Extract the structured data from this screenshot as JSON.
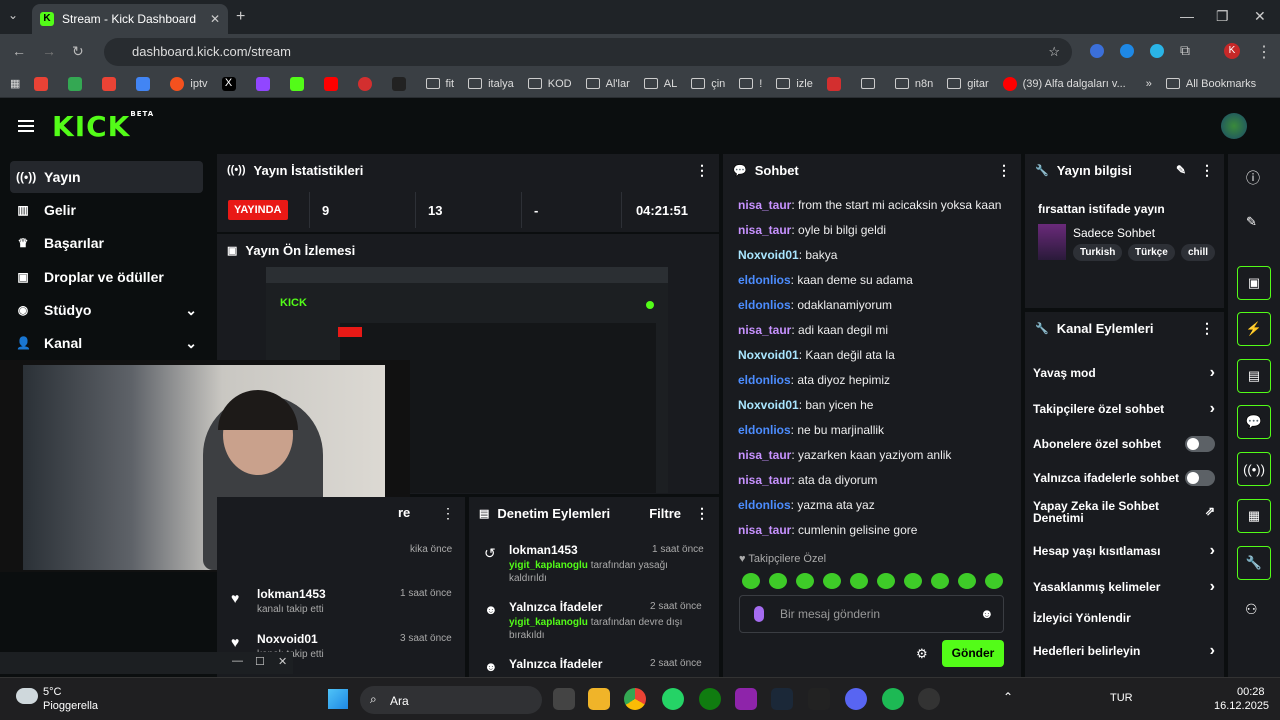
{
  "browser": {
    "tab_title": "Stream - Kick Dashboard",
    "url": "dashboard.kick.com/stream",
    "bookmarks": [
      "iptv",
      "fit",
      "italya",
      "KOD",
      "Al'lar",
      "AL",
      "çin",
      "!",
      "izle",
      "n8n",
      "gitar",
      "(39) Alfa dalgaları v..."
    ],
    "all_bookmarks": "All Bookmarks",
    "profile_letter": "K"
  },
  "header": {
    "logo": "KICK",
    "beta": "BETA"
  },
  "sidebar": {
    "items": [
      {
        "label": "Yayın",
        "icon": "broadcast-icon"
      },
      {
        "label": "Gelir",
        "icon": "chart-icon"
      },
      {
        "label": "Başarılar",
        "icon": "trophy-icon"
      },
      {
        "label": "Droplar ve ödüller",
        "icon": "gift-icon"
      },
      {
        "label": "Stüdyo",
        "icon": "studio-icon"
      },
      {
        "label": "Kanal",
        "icon": "channel-icon"
      }
    ]
  },
  "stats": {
    "title": "Yayın İstatistikleri",
    "live_badge": "YAYINDA",
    "viewers": "9",
    "followers": "13",
    "subs": "-",
    "duration": "04:21:51"
  },
  "preview": {
    "title": "Yayın Ön İzlemesi"
  },
  "activity": {
    "title_partial": "re",
    "time0": "kika önce",
    "items": [
      {
        "name": "lokman1453",
        "text": "kanalı takip etti",
        "time": "1 saat önce"
      },
      {
        "name": "Noxvoid01",
        "text": "kanalı takip etti",
        "time": "3 saat önce"
      }
    ]
  },
  "moderation": {
    "title": "Denetim Eylemleri",
    "filter": "Filtre",
    "items": [
      {
        "name": "lokman1453",
        "mod": "yigit_kaplanoglu",
        "action1": "tarafından yasağı",
        "action2": "kaldırıldı",
        "time": "1 saat önce"
      },
      {
        "name": "Yalnızca İfadeler",
        "mod": "yigit_kaplanoglu",
        "action1": "tarafından devre dışı",
        "action2": "bırakıldı",
        "time": "2 saat önce"
      },
      {
        "name": "Yalnızca İfadeler",
        "time": "2 saat önce"
      }
    ]
  },
  "chat": {
    "title": "Sohbet",
    "messages": [
      {
        "user": "nisa_taur",
        "text": "from the start mi acicaksin yoksa kaan"
      },
      {
        "user": "nisa_taur",
        "text": "oyle bi bilgi geldi"
      },
      {
        "user": "Noxvoid01",
        "text": "bakya"
      },
      {
        "user": "eldonlios",
        "text": "kaan deme su adama"
      },
      {
        "user": "eldonlios",
        "text": "odaklanamiyorum"
      },
      {
        "user": "nisa_taur",
        "text": "adi kaan degil mi"
      },
      {
        "user": "Noxvoid01",
        "text": "Kaan değil ata la"
      },
      {
        "user": "eldonlios",
        "text": "ata diyoz hepimiz"
      },
      {
        "user": "Noxvoid01",
        "text": "ban yicen he"
      },
      {
        "user": "eldonlios",
        "text": "ne bu marjinallik"
      },
      {
        "user": "nisa_taur",
        "text": "yazarken kaan yaziyom anlik"
      },
      {
        "user": "nisa_taur",
        "text": "ata da diyorum"
      },
      {
        "user": "eldonlios",
        "text": "yazma ata yaz"
      },
      {
        "user": "nisa_taur",
        "text": "cumlenin gelisine gore"
      }
    ],
    "followers_only": "Takipçilere Özel",
    "placeholder": "Bir mesaj gönderin",
    "send": "Gönder"
  },
  "info": {
    "title": "Yayın bilgisi",
    "stream_title": "fırsattan istifade yayın",
    "category": "Sadece Sohbet",
    "tags": [
      "Turkish",
      "Türkçe",
      "chill"
    ]
  },
  "channel_actions": {
    "title": "Kanal Eylemleri",
    "items": [
      {
        "label": "Yavaş mod",
        "type": "chevron"
      },
      {
        "label": "Takipçilere özel sohbet",
        "type": "chevron"
      },
      {
        "label": "Abonelere özel sohbet",
        "type": "toggle"
      },
      {
        "label": "Yalnızca ifadelerle sohbet",
        "type": "toggle"
      },
      {
        "label": "Yapay Zeka ile Sohbet",
        "label2": "Denetimi",
        "type": "external"
      },
      {
        "label": "Hesap yaşı kısıtlaması",
        "type": "chevron"
      },
      {
        "label": "Yasaklanmış kelimeler",
        "type": "chevron"
      },
      {
        "label": "İzleyici Yönlendir",
        "type": "none"
      },
      {
        "label": "Hedefleri belirleyin",
        "type": "chevron"
      }
    ]
  },
  "taskbar": {
    "temp": "5°C",
    "weather": "Pioggerella",
    "search": "Ara",
    "lang": "TUR",
    "time": "00:28",
    "date": "16.12.2025"
  },
  "colors": {
    "accent": "#53fc18",
    "live": "#e91916",
    "panel": "#191b1f",
    "bg": "#0b0e0f"
  }
}
